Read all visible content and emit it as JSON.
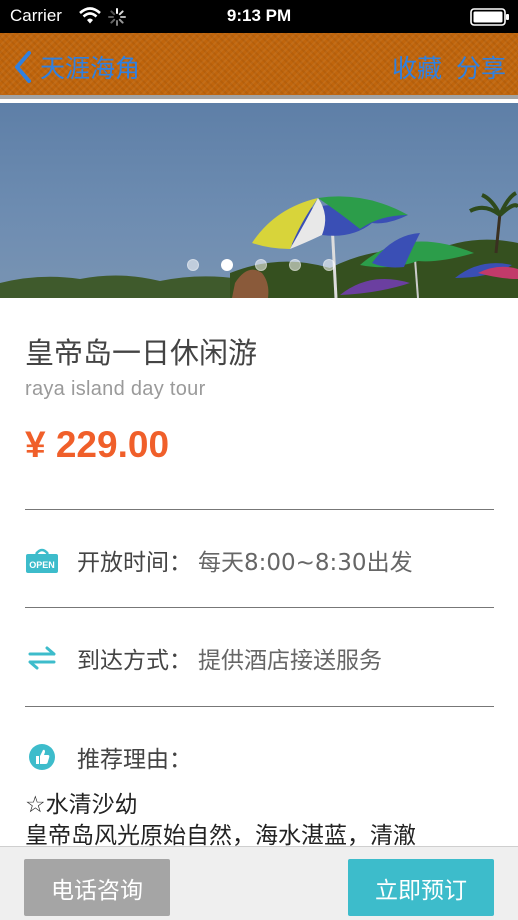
{
  "status_bar": {
    "carrier": "Carrier",
    "time": "9:13 PM"
  },
  "nav": {
    "back_label": "天涯海角",
    "favorite_label": "收藏",
    "share_label": "分享"
  },
  "hero": {
    "page_count": 5,
    "active_page": 2
  },
  "product": {
    "title": "皇帝岛一日休闲游",
    "subtitle": "raya island day tour",
    "price": "¥ 229.00"
  },
  "info": {
    "open_badge": "OPEN",
    "hours_label": "开放时间：",
    "hours_value": "每天8:00~8:30出发",
    "transport_label": "到达方式：",
    "transport_value": "提供酒店接送服务",
    "reason_label": "推荐理由："
  },
  "reason": {
    "line1": "☆水清沙幼",
    "line2": "皇帝岛风光原始自然，海水湛蓝，清澈"
  },
  "actions": {
    "call_label": "电话咨询",
    "book_label": "立即预订"
  },
  "colors": {
    "accent_blue": "#2f80e0",
    "price_orange": "#f05f2a",
    "teal": "#3dbccb",
    "nav_orange": "#c0650c"
  }
}
